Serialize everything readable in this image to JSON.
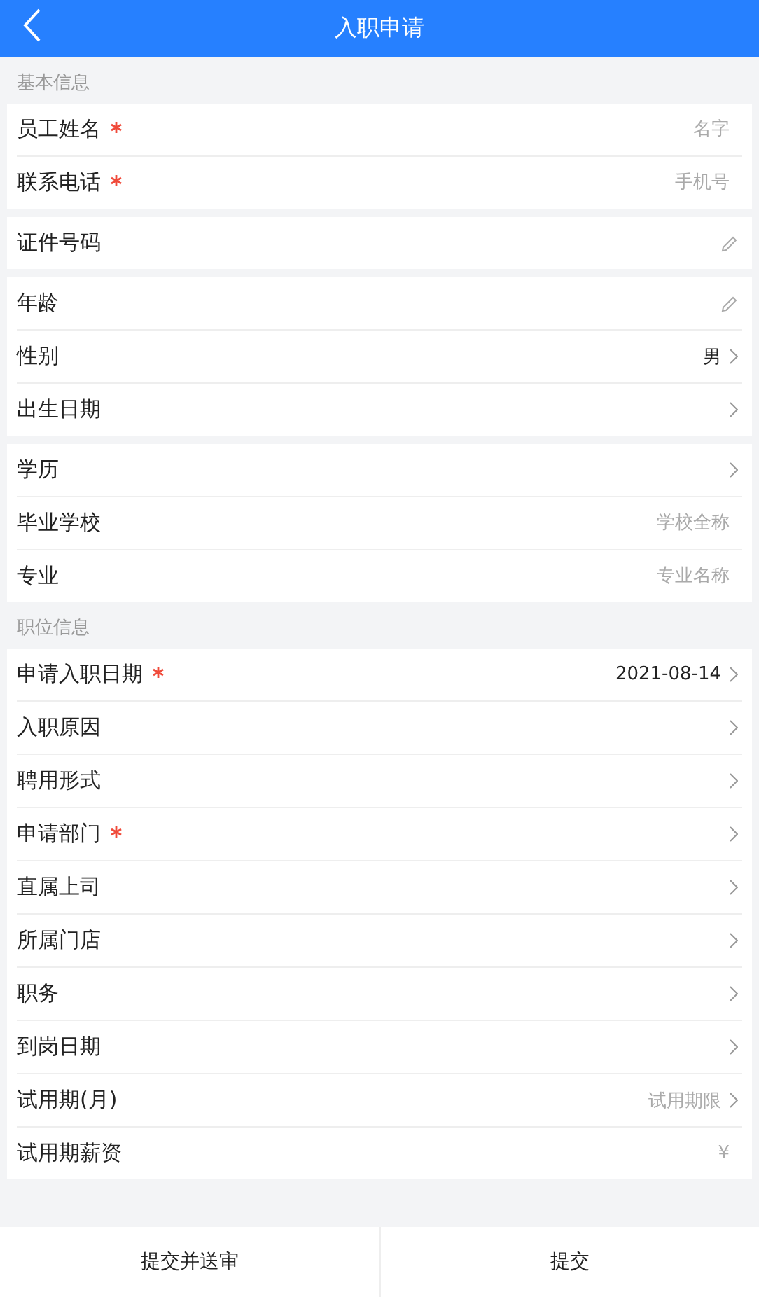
{
  "header": {
    "title": "入职申请"
  },
  "sections": [
    {
      "title": "基本信息",
      "groups": [
        [
          {
            "label": "员工姓名",
            "required": true,
            "kind": "input",
            "placeholder": "名字"
          },
          {
            "label": "联系电话",
            "required": true,
            "kind": "input",
            "placeholder": "手机号"
          }
        ],
        [
          {
            "label": "证件号码",
            "required": false,
            "kind": "edit"
          }
        ],
        [
          {
            "label": "年龄",
            "required": false,
            "kind": "edit"
          },
          {
            "label": "性别",
            "required": false,
            "kind": "select",
            "value": "男"
          },
          {
            "label": "出生日期",
            "required": false,
            "kind": "select"
          }
        ],
        [
          {
            "label": "学历",
            "required": false,
            "kind": "select"
          },
          {
            "label": "毕业学校",
            "required": false,
            "kind": "input",
            "placeholder": "学校全称"
          },
          {
            "label": "专业",
            "required": false,
            "kind": "input",
            "placeholder": "专业名称"
          }
        ]
      ]
    },
    {
      "title": "职位信息",
      "groups": [
        [
          {
            "label": "申请入职日期",
            "required": true,
            "kind": "select",
            "value": "2021-08-14"
          },
          {
            "label": "入职原因",
            "required": false,
            "kind": "select"
          },
          {
            "label": "聘用形式",
            "required": false,
            "kind": "select"
          },
          {
            "label": "申请部门",
            "required": true,
            "kind": "select"
          },
          {
            "label": "直属上司",
            "required": false,
            "kind": "select"
          },
          {
            "label": "所属门店",
            "required": false,
            "kind": "select"
          },
          {
            "label": "职务",
            "required": false,
            "kind": "select"
          },
          {
            "label": "到岗日期",
            "required": false,
            "kind": "select"
          },
          {
            "label": "试用期(月)",
            "required": false,
            "kind": "select",
            "placeholder": "试用期限"
          },
          {
            "label": "试用期薪资",
            "required": false,
            "kind": "money",
            "symbol": "¥"
          }
        ]
      ]
    }
  ],
  "footer": {
    "buttons": [
      "提交并送审",
      "提交"
    ]
  }
}
